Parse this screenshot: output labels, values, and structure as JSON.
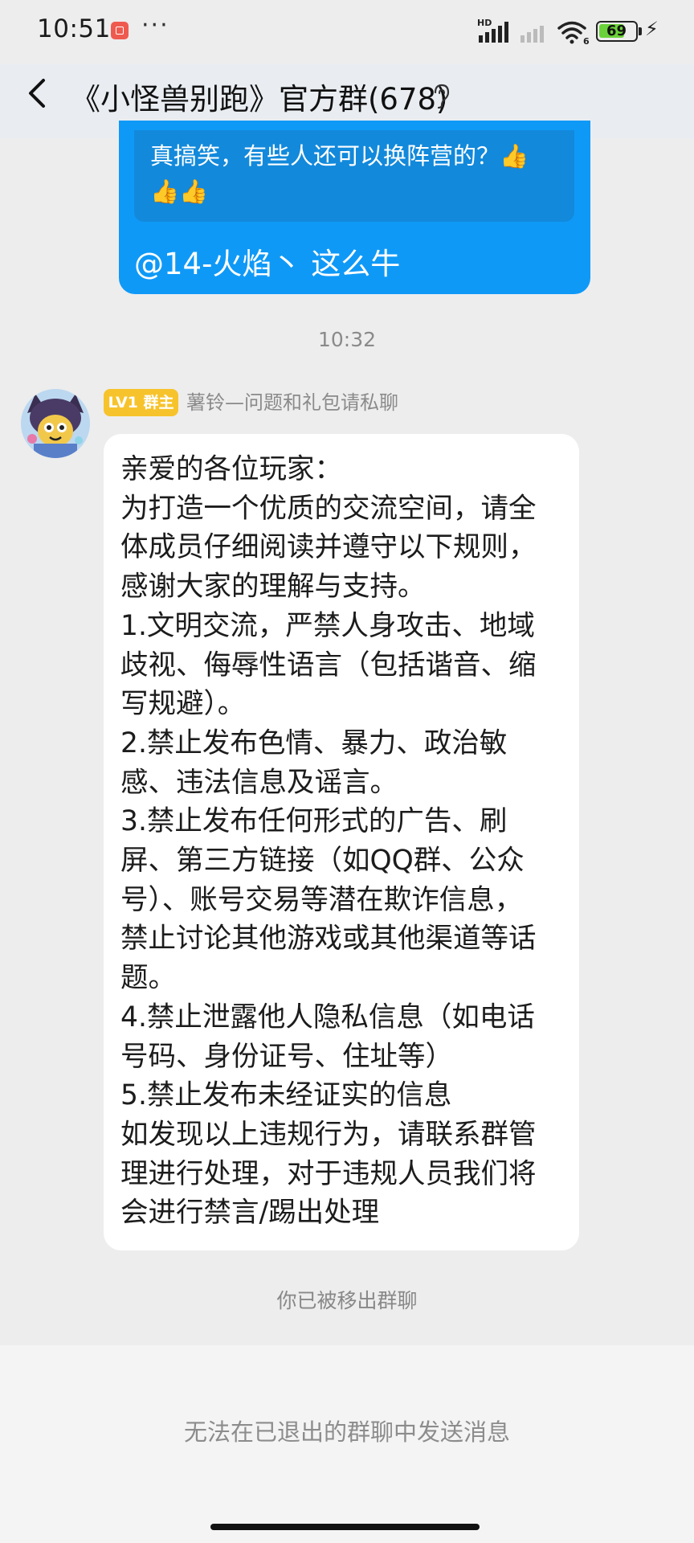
{
  "status_bar": {
    "time": "10:51",
    "overflow_dots": "···",
    "battery_level": "69",
    "hd_label": "HD",
    "wifi_badge": "6"
  },
  "header": {
    "title": "《小怪兽别跑》官方群(678)"
  },
  "outgoing_message": {
    "quoted_text": "真搞笑，有些人还可以换阵营的？👍👍👍",
    "text": "@14-火焰丶 这么牛"
  },
  "timestamp": "10:32",
  "incoming_message": {
    "badge": "LV1 群主",
    "sender": "薯铃—问题和礼包请私聊",
    "lines": [
      "亲爱的各位玩家：",
      "为打造一个优质的交流空间，请全",
      "体成员仔细阅读并遵守以下规则，",
      "感谢大家的理解与支持。",
      "1.文明交流，严禁人身攻击、地域",
      "歧视、侮辱性语言（包括谐音、缩",
      "写规避）。",
      "2.禁止发布色情、暴力、政治敏",
      "感、违法信息及谣言。",
      "3.禁止发布任何形式的广告、刷",
      "屏、第三方链接（如QQ群、公众",
      "号）、账号交易等潜在欺诈信息，",
      "禁止讨论其他游戏或其他渠道等话",
      "题。",
      "4.禁止泄露他人隐私信息（如电话",
      "号码、身份证号、住址等）",
      "5.禁止发布未经证实的信息",
      "如发现以上违规行为，请联系群管",
      "理进行处理，对于违规人员我们将",
      "会进行禁言/踢出处理"
    ]
  },
  "system_notice": "你已被移出群聊",
  "input_placeholder": "无法在已退出的群聊中发送消息",
  "colors": {
    "bubble_blue": "#0f99f7",
    "badge_yellow": "#f7c32c",
    "background": "#ededed"
  }
}
